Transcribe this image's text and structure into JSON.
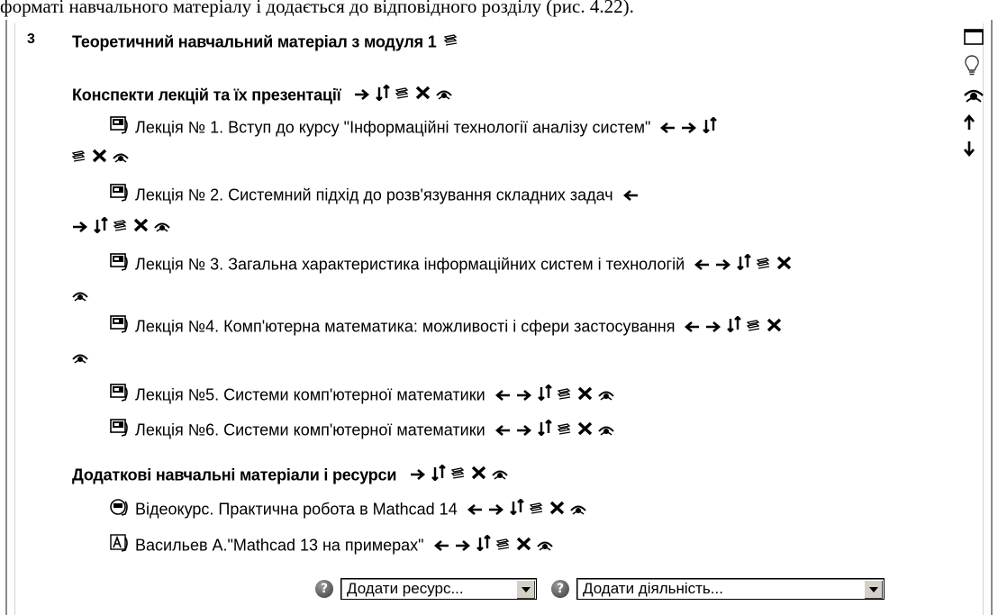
{
  "doc_top_text": "форматі навчального матеріалу і додається до відповідного розділу (рис. 4.22).",
  "section": {
    "number": "3",
    "title": "Теоретичний навчальний матеріал з модуля 1"
  },
  "labels": [
    {
      "title": "Конспекти лекцій та їх презентації"
    },
    {
      "title": "Додаткові навчальні матеріали і ресурси"
    }
  ],
  "resources": [
    {
      "icon": "powerpoint-icon",
      "title": "Лекція № 1. Вступ до курсу \"Інформаційні технології аналізу систем\""
    },
    {
      "icon": "powerpoint-icon",
      "title": "Лекція № 2. Системний підхід до розв'язування складних задач"
    },
    {
      "icon": "powerpoint-icon",
      "title": "Лекція № 3. Загальна характеристика інформаційних систем і технологій"
    },
    {
      "icon": "powerpoint-icon",
      "title": "Лекція №4. Комп'ютерна математика: можливості і сфери застосування"
    },
    {
      "icon": "powerpoint-icon",
      "title": "Лекція №5. Системи комп'ютерної математики"
    },
    {
      "icon": "powerpoint-icon",
      "title": "Лекція №6. Системи комп'ютерної математики"
    },
    {
      "icon": "video-icon",
      "title": "Відеокурс. Практична робота в Mathcad 14"
    },
    {
      "icon": "pdf-icon",
      "title": "Васильев А.\"Mathcad 13 на примерах\""
    }
  ],
  "controls": {
    "move_left": "left-arrow-icon",
    "move_right": "right-arrow-icon",
    "move": "move-icon",
    "edit": "edit-icon",
    "delete": "delete-icon",
    "hide": "eye-icon"
  },
  "right_tools": [
    "show-only-section-icon",
    "highlight-lightbulb-icon",
    "hide-section-eye-icon",
    "move-up-icon",
    "move-down-icon"
  ],
  "add_bar": {
    "help": "?",
    "add_resource": "Додати ресурс...",
    "add_activity": "Додати діяльність..."
  },
  "colors": {
    "border": "#8c8c8c",
    "button_face": "#d4d0c8"
  }
}
